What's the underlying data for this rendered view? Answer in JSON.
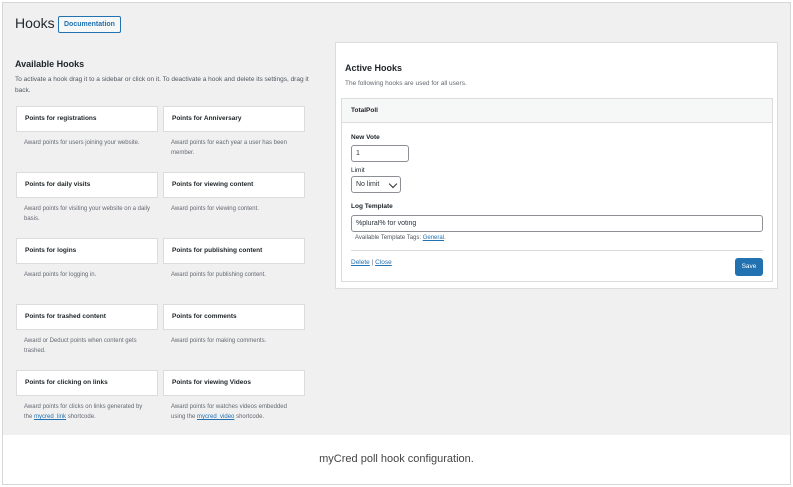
{
  "header": {
    "title": "Hooks",
    "documentation_label": "Documentation"
  },
  "available": {
    "title": "Available Hooks",
    "description": "To activate a hook drag it to a sidebar or click on it. To deactivate a hook and delete its settings, drag it back.",
    "hooks": [
      {
        "title": "Points for registrations",
        "description": "Award points for users joining your website."
      },
      {
        "title": "Points for Anniversary",
        "description": "Award points for each year a user has been member."
      },
      {
        "title": "Points for daily visits",
        "description": "Award points for visiting your website on a daily basis."
      },
      {
        "title": "Points for viewing content",
        "description": "Award points for viewing content."
      },
      {
        "title": "Points for logins",
        "description": "Award points for logging in."
      },
      {
        "title": "Points for publishing content",
        "description": "Award points for publishing content."
      },
      {
        "title": "Points for trashed content",
        "description": "Award or Deduct points when content gets trashed."
      },
      {
        "title": "Points for comments",
        "description": "Award points for making comments."
      },
      {
        "title": "Points for clicking on links",
        "description_before": "Award points for clicks on links generated by the",
        "description_link": "mycred_link",
        "description_after": "shortcode."
      },
      {
        "title": "Points for viewing Videos",
        "description_before": "Award points for watches videos embedded using the",
        "description_link": "mycred_video",
        "description_after": "shortcode."
      }
    ]
  },
  "active": {
    "title": "Active Hooks",
    "description": "The following hooks are used for all users.",
    "widget": {
      "title": "TotalPoll",
      "new_vote_label": "New Vote",
      "new_vote_value": "1",
      "limit_label": "Limit",
      "limit_value": "No limit",
      "log_template_label": "Log Template",
      "log_template_value": "%plural% for voting",
      "template_tags_prefix": "Available Template Tags:",
      "template_tags_link": "General",
      "template_tags_suffix": ".",
      "delete_label": "Delete",
      "separator": "|",
      "close_label": "Close",
      "save_label": "Save"
    }
  },
  "caption": "myCred poll hook configuration.",
  "colors": {
    "accent": "#2271b1",
    "background": "#f0f0f1",
    "card": "#ffffff",
    "border": "#dcdcde"
  }
}
